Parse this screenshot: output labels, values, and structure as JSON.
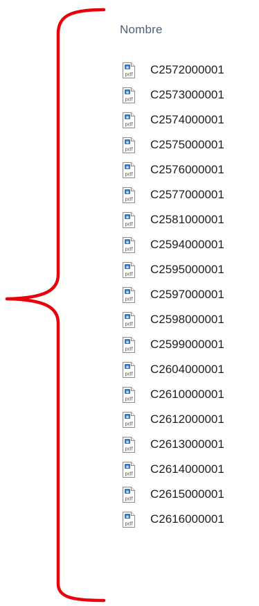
{
  "list": {
    "column_header": "Nombre",
    "file_icon": "pdf-file-icon",
    "files": [
      "C2572000001",
      "C2573000001",
      "C2574000001",
      "C2575000001",
      "C2576000001",
      "C2577000001",
      "C2581000001",
      "C2594000001",
      "C2595000001",
      "C2597000001",
      "C2598000001",
      "C2599000001",
      "C2604000001",
      "C2610000001",
      "C2612000001",
      "C2613000001",
      "C2614000001",
      "C2615000001",
      "C2616000001"
    ]
  },
  "annotation": {
    "shape": "curly-brace",
    "color": "#e8000b"
  }
}
